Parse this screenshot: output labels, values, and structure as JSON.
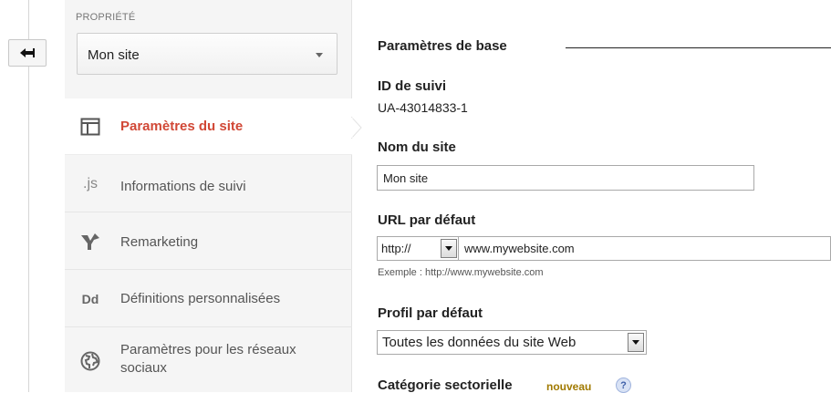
{
  "property": {
    "label": "PROPRIÉTÉ",
    "selected": "Mon site"
  },
  "nav": {
    "items": [
      {
        "label": "Paramètres du site",
        "icon": "layout-icon",
        "active": true
      },
      {
        "label": "Informations de suivi",
        "icon": "js-icon",
        "active": false
      },
      {
        "label": "Remarketing",
        "icon": "remarketing-icon",
        "active": false
      },
      {
        "label": "Définitions personnalisées",
        "icon": "dd-icon",
        "active": false
      },
      {
        "label_line1": "Paramètres pour les réseaux",
        "label_line2": "sociaux",
        "icon": "globe-icon",
        "active": false
      }
    ]
  },
  "icon_text": {
    "js": ".js",
    "dd": "Dd"
  },
  "main": {
    "section_title": "Paramètres de base",
    "tracking_id": {
      "label": "ID de suivi",
      "value": "UA-43014833-1"
    },
    "site_name": {
      "label": "Nom du site",
      "value": "Mon site"
    },
    "default_url": {
      "label": "URL par défaut",
      "protocol": "http://",
      "value": "www.mywebsite.com",
      "example": "Exemple : http://www.mywebsite.com"
    },
    "default_profile": {
      "label": "Profil par défaut",
      "value": "Toutes les données du site Web"
    },
    "category": {
      "label": "Catégorie sectorielle",
      "badge": "nouveau",
      "help": "?"
    }
  },
  "colors": {
    "active": "#d14836",
    "badge": "#a17a00",
    "help": "#5b7fc7"
  }
}
